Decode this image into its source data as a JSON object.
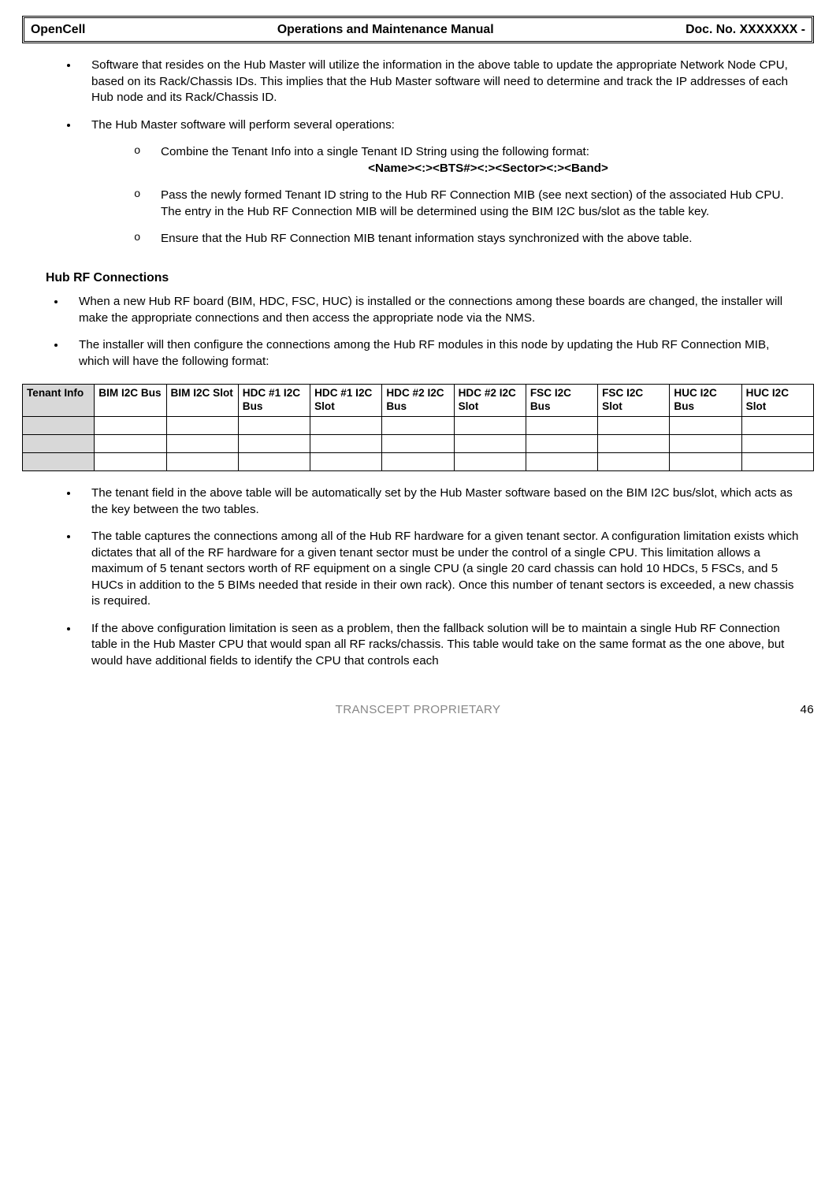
{
  "header": {
    "left": "OpenCell",
    "center": "Operations and Maintenance Manual",
    "right": "Doc. No.  XXXXXXX -"
  },
  "top_bullets": {
    "b1": "Software that resides on the Hub Master will utilize the information in the above table to update the appropriate Network Node CPU, based on its Rack/Chassis IDs. This implies that the Hub Master software will need to determine and track the IP addresses of each Hub node and its Rack/Chassis ID.",
    "b2": "The Hub Master software will perform several operations:",
    "b2_sub": {
      "s1a": "Combine the Tenant Info into a single Tenant ID String using the following format:",
      "s1b_format": "<Name><:><BTS#><:><Sector><:><Band>",
      "s2": "Pass the newly formed Tenant ID string to the Hub RF Connection MIB (see next section) of the associated Hub CPU. The entry in the Hub RF Connection MIB will be determined using the BIM I2C bus/slot as the table key.",
      "s3": "Ensure that the Hub RF Connection MIB tenant information stays synchronized with the above table."
    }
  },
  "section_heading": "Hub RF Connections",
  "mid_bullets": {
    "b1": "When a new Hub RF board (BIM, HDC, FSC, HUC) is installed or the connections among these boards are changed, the installer will make the appropriate connections and then access the appropriate node via the NMS.",
    "b2": "The installer will then configure the connections among the Hub RF modules in this node by updating the Hub RF Connection MIB, which will have the following format:"
  },
  "table": {
    "headers": [
      "Tenant Info",
      "BIM I2C Bus",
      "BIM I2C Slot",
      "HDC #1 I2C Bus",
      "HDC #1 I2C Slot",
      "HDC #2 I2C Bus",
      "HDC #2 I2C Slot",
      "FSC I2C Bus",
      "FSC I2C Slot",
      "HUC I2C Bus",
      "HUC I2C Slot"
    ],
    "rows": [
      [
        "",
        "",
        "",
        "",
        "",
        "",
        "",
        "",
        "",
        "",
        ""
      ],
      [
        "",
        "",
        "",
        "",
        "",
        "",
        "",
        "",
        "",
        "",
        ""
      ],
      [
        "",
        "",
        "",
        "",
        "",
        "",
        "",
        "",
        "",
        "",
        ""
      ]
    ]
  },
  "bottom_bullets": {
    "b1": "The tenant field in the above table will be automatically set by the Hub Master software based on the BIM I2C bus/slot, which acts as the key between the two tables.",
    "b2": "The table captures the connections among all of the Hub RF hardware for a given tenant sector. A configuration limitation exists which dictates that all of the RF hardware for a given tenant sector must be under the control of a single CPU. This limitation allows a maximum of 5 tenant sectors worth of RF equipment on a single CPU (a single 20 card chassis can hold 10 HDCs, 5 FSCs, and 5 HUCs in addition to the 5 BIMs needed that reside in their own rack). Once this number of tenant sectors is exceeded, a new chassis is required.",
    "b3": "If the above configuration limitation is seen as a problem, then the fallback solution will be to maintain a single Hub RF Connection table in the Hub Master CPU that would span all RF racks/chassis. This table would take on the same format as the one above, but would have additional fields to identify the CPU that controls each"
  },
  "footer": {
    "center": "TRANSCEPT PROPRIETARY",
    "page": "46"
  }
}
